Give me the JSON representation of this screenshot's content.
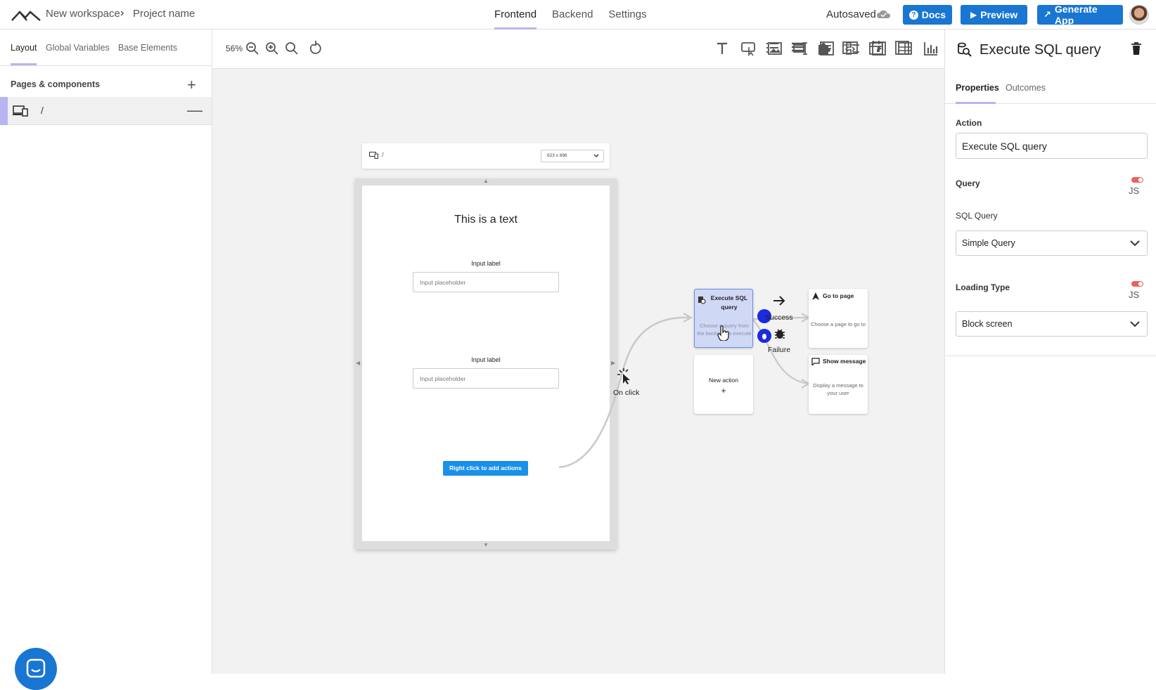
{
  "topbar": {
    "workspace": "New workspace",
    "project": "Project name",
    "tabs": [
      "Frontend",
      "Backend",
      "Settings"
    ],
    "active_tab": "Frontend",
    "autosaved": "Autosaved",
    "docs_label": "Docs",
    "preview_label": "Preview",
    "generate_label": "Generate App",
    "accent_color": "#1976d2"
  },
  "left": {
    "tabs": [
      "Layout",
      "Global Variables",
      "Base Elements"
    ],
    "section_title": "Pages & components",
    "page_path": "/"
  },
  "canvas": {
    "zoom": "56%",
    "device_path": "/",
    "device_size": "623 x 896",
    "page": {
      "text": "This is a text",
      "input1_label": "Input label",
      "input1_placeholder": "Input placeholder",
      "input2_label": "Input label",
      "input2_placeholder": "Input placeholder",
      "button": "Right click to add actions"
    },
    "flow": {
      "trigger": "On click",
      "node_sql_title": "Execute SQL query",
      "node_sql_desc": "Choose a query from the backend to execute",
      "node_new_title": "New action",
      "node_new_plus": "+",
      "success": "Success",
      "failure": "Failure",
      "node_goto_title": "Go to page",
      "node_goto_desc": "Choose a page to go to",
      "node_msg_title": "Show message",
      "node_msg_desc": "Display a message to your user"
    }
  },
  "right": {
    "title": "Execute SQL query",
    "tabs": [
      "Properties",
      "Outcomes"
    ],
    "action_label": "Action",
    "action_value": "Execute SQL query",
    "query_label": "Query",
    "js": "JS",
    "sql_query_label": "SQL Query",
    "sql_query_value": "Simple Query",
    "loading_label": "Loading Type",
    "loading_value": "Block screen",
    "toggle_color": "#ec6060"
  }
}
